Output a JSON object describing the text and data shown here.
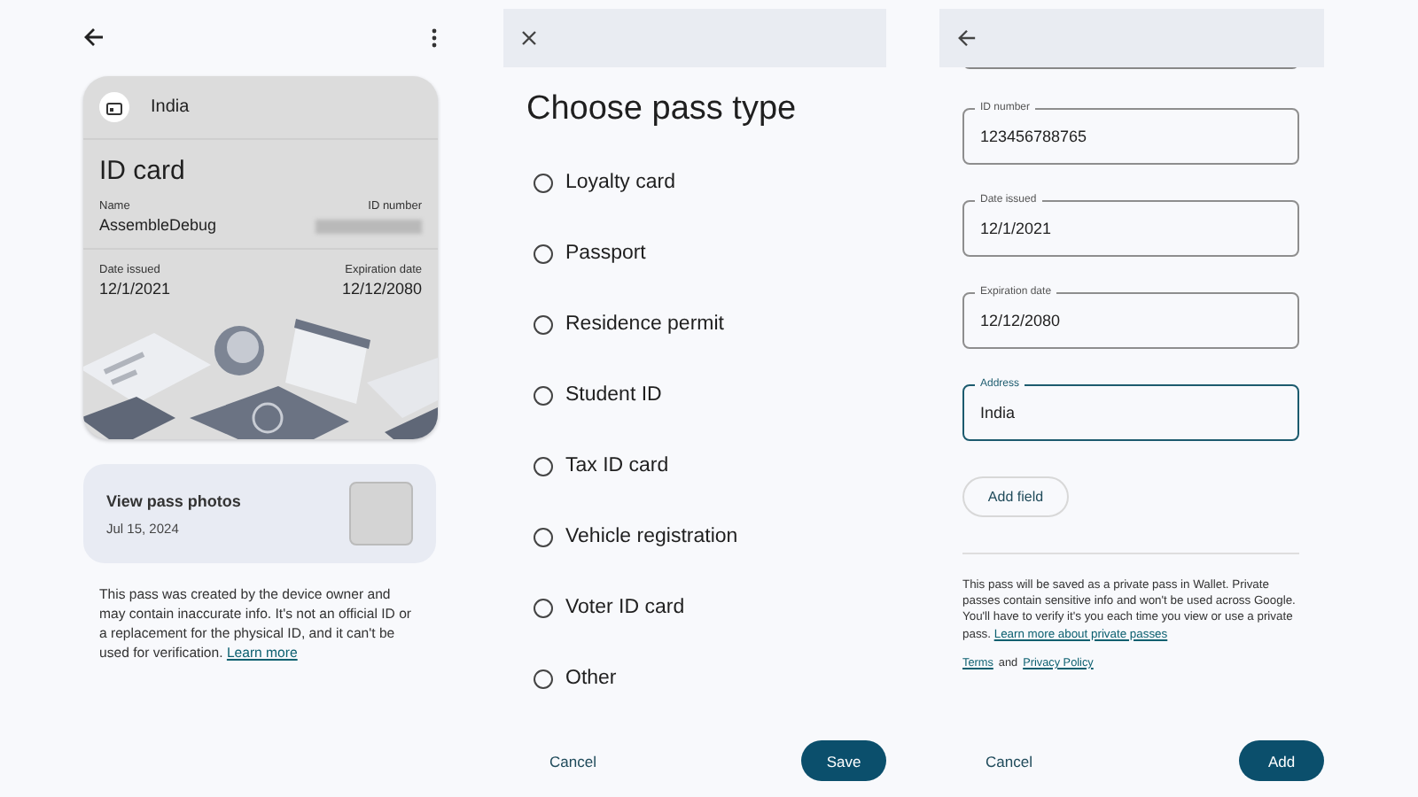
{
  "pass_detail": {
    "card": {
      "country": "India",
      "title": "ID card",
      "rows": [
        [
          {
            "label": "Name",
            "value": "AssembleDebug"
          },
          {
            "label": "ID number",
            "redacted": true
          }
        ],
        [
          {
            "label": "Date issued",
            "value": "12/1/2021"
          },
          {
            "label": "Expiration date",
            "value": "12/12/2080"
          }
        ]
      ]
    },
    "photos": {
      "title": "View pass photos",
      "date": "Jul 15, 2024"
    },
    "disclaimer": "This pass was created by the device owner and may contain inaccurate info. It's not an official ID or a replacement for the physical ID, and it can't be used for verification.",
    "disclaimer_link": "Learn more"
  },
  "choose_type": {
    "title": "Choose pass type",
    "options": [
      {
        "label": "Loyalty card",
        "selected": false
      },
      {
        "label": "Passport",
        "selected": false
      },
      {
        "label": "Residence permit",
        "selected": false
      },
      {
        "label": "Student ID",
        "selected": false
      },
      {
        "label": "Tax ID card",
        "selected": false
      },
      {
        "label": "Vehicle registration",
        "selected": false
      },
      {
        "label": "Voter ID card",
        "selected": false
      },
      {
        "label": "Other",
        "selected": false
      }
    ],
    "cancel": "Cancel",
    "save": "Save"
  },
  "add_form": {
    "fields": [
      {
        "label": "ID number",
        "value": "123456788765",
        "focused": false
      },
      {
        "label": "Date issued",
        "value": "12/1/2021",
        "focused": false
      },
      {
        "label": "Expiration date",
        "value": "12/12/2080",
        "focused": false
      },
      {
        "label": "Address",
        "value": "India",
        "focused": true
      }
    ],
    "add_field": "Add field",
    "notice": "This pass will be saved as a private pass in Wallet. Private passes contain sensitive info and won't be used across Google. You'll have to verify it's you each time you view or use a private pass.",
    "notice_link": "Learn more about private passes",
    "terms": "Terms",
    "terms_join": "and",
    "privacy": "Privacy Policy",
    "cancel": "Cancel",
    "add": "Add"
  }
}
